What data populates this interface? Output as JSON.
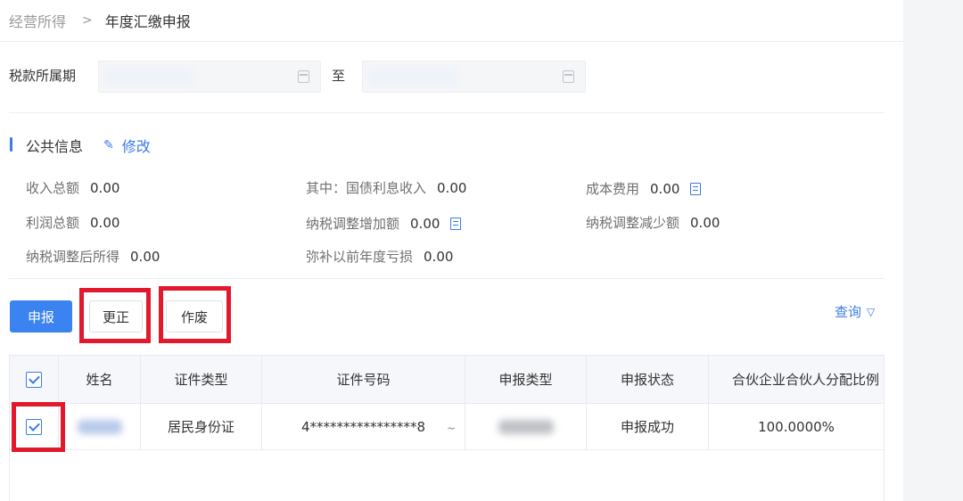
{
  "breadcrumb": {
    "parent": "经营所得",
    "separator": ">",
    "current": "年度汇缴申报"
  },
  "filter": {
    "period_label": "税款所属期",
    "to_label": "至"
  },
  "public_info": {
    "title": "公共信息",
    "edit_label": "修改",
    "items": [
      {
        "label": "收入总额",
        "value": "0.00"
      },
      {
        "label": "其中：国债利息收入",
        "value": "0.00"
      },
      {
        "label": "成本费用",
        "value": "0.00"
      },
      {
        "label": "利润总额",
        "value": "0.00"
      },
      {
        "label": "纳税调整增加额",
        "value": "0.00"
      },
      {
        "label": "纳税调整减少额",
        "value": "0.00"
      },
      {
        "label": "纳税调整后所得",
        "value": "0.00"
      },
      {
        "label": "弥补以前年度亏损",
        "value": "0.00"
      }
    ]
  },
  "toolbar": {
    "declare_label": "申报",
    "correct_label": "更正",
    "void_label": "作废",
    "query_label": "查询"
  },
  "table": {
    "columns": [
      "姓名",
      "证件类型",
      "证件号码",
      "申报类型",
      "申报状态",
      "合伙企业合伙人分配比例"
    ],
    "rows": [
      {
        "id_type": "居民身份证",
        "id_number": "4****************8",
        "id_tail": "~",
        "status": "申报成功",
        "ratio": "100.0000%"
      }
    ]
  },
  "colors": {
    "primary": "#3a83f0",
    "link": "#3b7ce5",
    "highlight": "#e2192c"
  },
  "icons": [
    "chevron-right-icon",
    "calendar-icon",
    "pencil-icon",
    "document-icon",
    "chevron-down-icon",
    "checkbox-checked-icon"
  ]
}
